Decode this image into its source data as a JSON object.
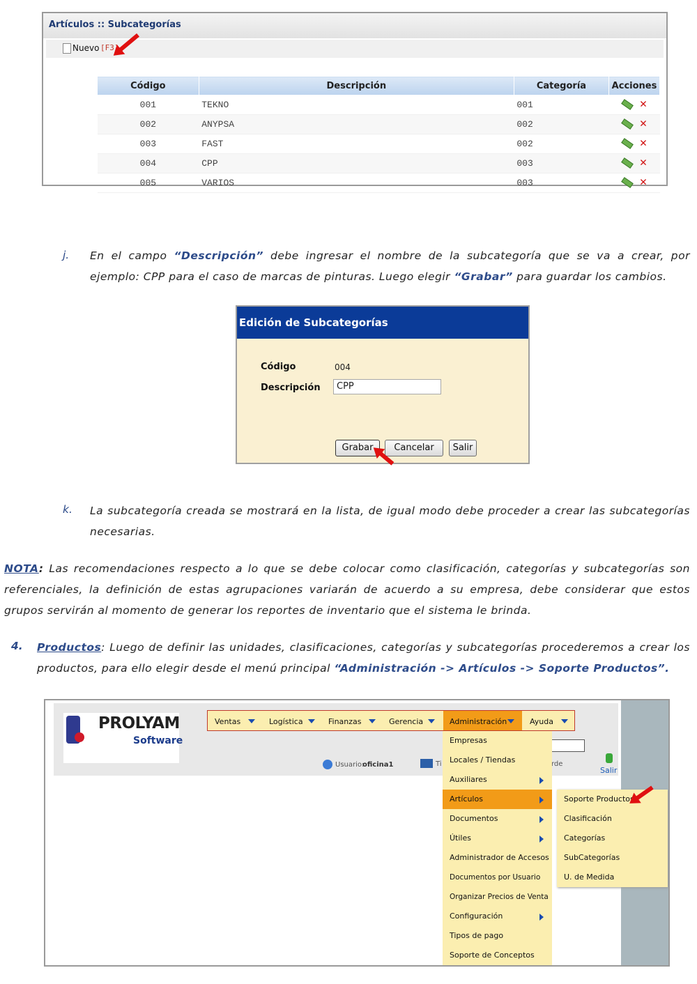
{
  "panel1": {
    "title": "Artículos :: Subcategorías",
    "nuevo": "Nuevo",
    "shortcut": "[F3]",
    "columns": [
      "Código",
      "Descripción",
      "Categoría",
      "Acciones"
    ],
    "rows": [
      {
        "codigo": "001",
        "descripcion": "TEKNO",
        "categoria": "001"
      },
      {
        "codigo": "002",
        "descripcion": "ANYPSA",
        "categoria": "002"
      },
      {
        "codigo": "003",
        "descripcion": "FAST",
        "categoria": "002"
      },
      {
        "codigo": "004",
        "descripcion": "CPP",
        "categoria": "003"
      },
      {
        "codigo": "005",
        "descripcion": "VARIOS",
        "categoria": "003"
      }
    ]
  },
  "para_j": {
    "label": "j.",
    "t1": "En el campo ",
    "h1": "“Descripción”",
    "t2": "  debe ingresar el nombre de la subcategoría que se va a crear, por ejemplo: CPP para el caso de marcas de pinturas. Luego elegir ",
    "h2": "“Grabar”",
    "t3": " para guardar los cambios."
  },
  "dialog": {
    "title": "Edición de Subcategorías",
    "codigo_label": "Código",
    "codigo_value": "004",
    "desc_label": "Descripción",
    "desc_value": "CPP",
    "grabar": "Grabar",
    "cancelar": "Cancelar",
    "salir": "Salir"
  },
  "para_k": {
    "label": "k.",
    "text": "La subcategoría creada se mostrará en la lista, de igual modo debe proceder a crear las subcategorías necesarias."
  },
  "nota": {
    "label": "NOTA",
    "colon": ":",
    "text": " Las recomendaciones respecto a lo que se debe colocar como clasificación, categorías y subcategorías son referenciales, la definición de estas agrupaciones variarán de acuerdo a su empresa, debe considerar que estos grupos servirán al momento de generar los reportes de inventario que el sistema le brinda."
  },
  "item4": {
    "number": "4.",
    "link": "Productos",
    "t1": ": Luego de definir las unidades, clasificaciones, categorías y subcategorías procederemos a crear los productos, para ello elegir desde el menú principal ",
    "h1": "“Administración -> Artículos -> Soporte Productos”."
  },
  "app": {
    "logo_main": "PROLYAM",
    "logo_sub": "Software",
    "menu": [
      "Ventas",
      "Logística",
      "Finanzas",
      "Gerencia",
      "Administración",
      "Ayuda"
    ],
    "usuario_label": "Usuario:",
    "usuario_value": "oficina1",
    "partial_1": "Ti",
    "partial_2": "rde",
    "salir": "Salir",
    "admin_items": [
      "Empresas",
      "Locales / Tiendas",
      "Auxiliares",
      "Artículos",
      "Documentos",
      "Útiles",
      "Administrador de Accesos",
      "Documentos por Usuario",
      "Organizar Precios de Venta",
      "Configuración",
      "Tipos de pago",
      "Soporte de Conceptos"
    ],
    "articulos_items": [
      "Soporte Productos",
      "Clasificación",
      "Categorías",
      "SubCategorías",
      "U. de Medida"
    ],
    "colors": {
      "menu_active": "#f29b18",
      "submenu_bg": "#fbeeb0",
      "header_bg": "#e8e8e8",
      "sidebar": "#a9b7bd"
    }
  }
}
